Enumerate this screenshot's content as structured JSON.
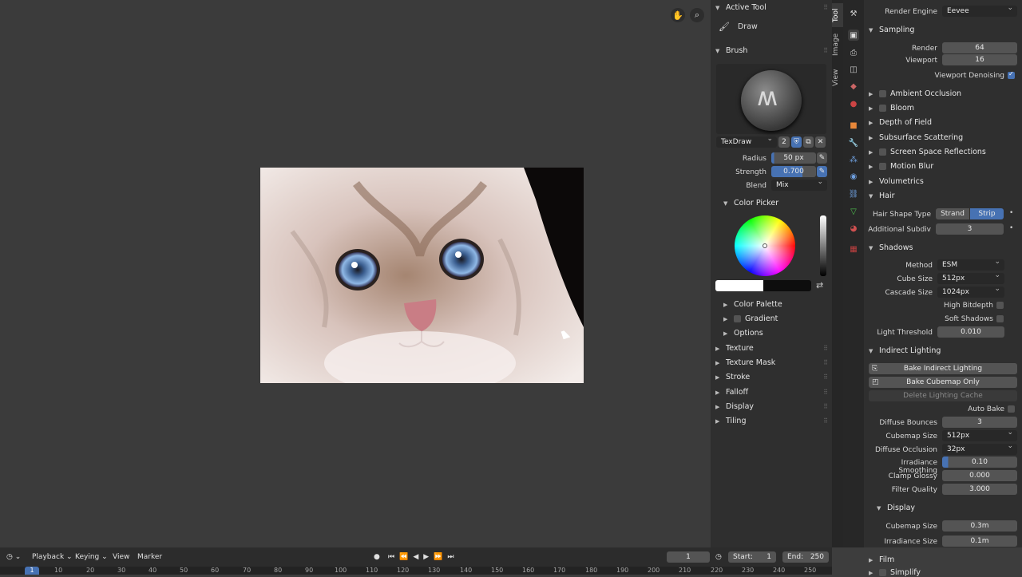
{
  "tool_panel": {
    "active_tool_header": "Active Tool",
    "active_tool_name": "Draw",
    "brush_header": "Brush",
    "brush_name": "TexDraw",
    "brush_users": "2",
    "radius_label": "Radius",
    "radius_value": "50 px",
    "strength_label": "Strength",
    "strength_value": "0.700",
    "blend_label": "Blend",
    "blend_value": "Mix",
    "color_picker_header": "Color Picker",
    "color_palette": "Color Palette",
    "gradient": "Gradient",
    "options": "Options",
    "sections": [
      "Texture",
      "Texture Mask",
      "Stroke",
      "Falloff",
      "Display",
      "Tiling"
    ]
  },
  "vertical_tabs": [
    "Tool",
    "Image",
    "View"
  ],
  "properties": {
    "render_engine_label": "Render Engine",
    "render_engine_value": "Eevee",
    "sampling_header": "Sampling",
    "render_label": "Render",
    "render_value": "64",
    "viewport_label": "Viewport",
    "viewport_value": "16",
    "viewport_denoising": "Viewport Denoising",
    "ambient_occlusion": "Ambient Occlusion",
    "bloom": "Bloom",
    "depth_of_field": "Depth of Field",
    "subsurface_scattering": "Subsurface Scattering",
    "screen_space_reflections": "Screen Space Reflections",
    "motion_blur": "Motion Blur",
    "volumetrics": "Volumetrics",
    "hair_header": "Hair",
    "hair_shape_type_label": "Hair Shape Type",
    "hair_strand": "Strand",
    "hair_strip": "Strip",
    "additional_subdiv_label": "Additional Subdiv",
    "additional_subdiv_value": "3",
    "shadows_header": "Shadows",
    "method_label": "Method",
    "method_value": "ESM",
    "cube_size_label": "Cube Size",
    "cube_size_value": "512px",
    "cascade_size_label": "Cascade Size",
    "cascade_size_value": "1024px",
    "high_bitdepth": "High Bitdepth",
    "soft_shadows": "Soft Shadows",
    "light_threshold_label": "Light Threshold",
    "light_threshold_value": "0.010",
    "indirect_lighting_header": "Indirect Lighting",
    "bake_indirect": "Bake Indirect Lighting",
    "bake_cubemap": "Bake Cubemap Only",
    "delete_cache": "Delete Lighting Cache",
    "auto_bake": "Auto Bake",
    "diffuse_bounces_label": "Diffuse Bounces",
    "diffuse_bounces_value": "3",
    "cubemap_size_label": "Cubemap Size",
    "cubemap_size_value": "512px",
    "diffuse_occlusion_label": "Diffuse Occlusion",
    "diffuse_occlusion_value": "32px",
    "irradiance_smoothing_label": "Irradiance Smoothing",
    "irradiance_smoothing_value": "0.10",
    "clamp_glossy_label": "Clamp Glossy",
    "clamp_glossy_value": "0.000",
    "filter_quality_label": "Filter Quality",
    "filter_quality_value": "3.000",
    "display_header": "Display",
    "display_cubemap_label": "Cubemap Size",
    "display_cubemap_value": "0.3m",
    "display_irradiance_label": "Irradiance Size",
    "display_irradiance_value": "0.1m",
    "film_header": "Film",
    "simplify_header": "Simplify"
  },
  "timeline": {
    "menus": [
      "Playback",
      "Keying",
      "View",
      "Marker"
    ],
    "current_frame": "1",
    "start_label": "Start:",
    "start_value": "1",
    "end_label": "End:",
    "end_value": "250",
    "ruler_marker": "1",
    "ruler_ticks": [
      "10",
      "20",
      "30",
      "40",
      "50",
      "60",
      "70",
      "80",
      "90",
      "100",
      "110",
      "120",
      "130",
      "140",
      "150",
      "160",
      "170",
      "180",
      "190",
      "200",
      "210",
      "220",
      "230",
      "240",
      "250"
    ]
  }
}
